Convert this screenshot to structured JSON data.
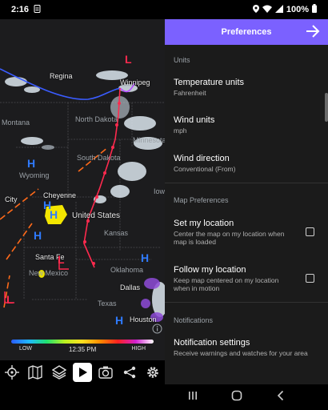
{
  "status_bar": {
    "time": "2:16",
    "battery": "100%"
  },
  "map": {
    "cities": [
      "Regina",
      "Winnipeg",
      "Montana",
      "North Dakota",
      "Minnesota",
      "South Dakota",
      "Wyoming",
      "Cheyenne",
      "United States",
      "Kansas",
      "Iowa",
      "City",
      "Santa Fe",
      "New Mexico",
      "Oklahoma",
      "Dallas",
      "Texas",
      "Houston"
    ],
    "legend": {
      "low_label": "LOW",
      "time": "12:35 PM",
      "high_label": "HIGH"
    }
  },
  "toolbar": {
    "icons": [
      "locate-icon",
      "map-icon",
      "layers-icon",
      "play-icon",
      "camera-icon",
      "share-icon",
      "settings-icon"
    ]
  },
  "preferences": {
    "title": "Preferences",
    "sections": {
      "units": "Units",
      "map_preferences": "Map Preferences",
      "notifications": "Notifications"
    },
    "items": [
      {
        "title": "Temperature units",
        "value": "Fahrenheit"
      },
      {
        "title": "Wind units",
        "value": "mph"
      },
      {
        "title": "Wind direction",
        "value": "Conventional (From)"
      },
      {
        "title": "Set my location",
        "value": "Center the map on my location when map is loaded",
        "checked": false
      },
      {
        "title": "Follow my location",
        "value": "Keep map centered on my location when in motion",
        "checked": false
      },
      {
        "title": "Notification settings",
        "value": "Receive warnings and watches for your area"
      }
    ]
  },
  "colors": {
    "accent": "#7b61ff",
    "panel_bg": "#1b1b1b",
    "map_bg": "#1c1c1e",
    "cold_front": "#2f5bff",
    "warm_front": "#ff2a4e"
  }
}
